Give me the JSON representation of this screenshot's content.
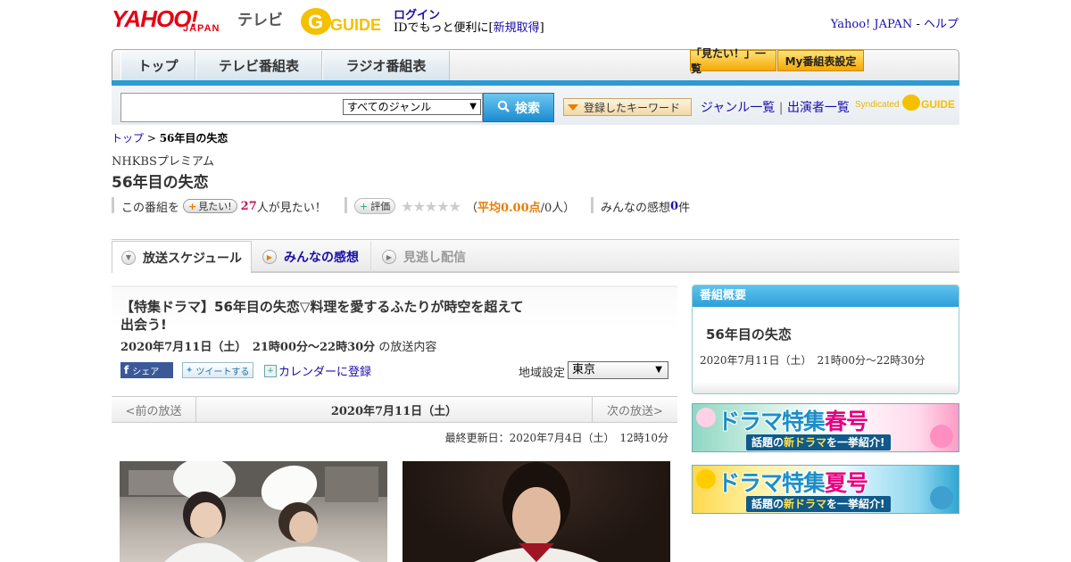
{
  "header": {
    "logo_yahoo": "YAHOO!",
    "logo_japan": "JAPAN",
    "logo_tv": "テレビ",
    "gguide_logo": "G GUIDE",
    "login": "ログイン",
    "login_prefix": "IDでもっと便利に[",
    "register": "新規取得",
    "login_suffix": "]",
    "yahoo_japan_link": "Yahoo! JAPAN",
    "help_sep": " - ",
    "help_link": "ヘルプ"
  },
  "nav": {
    "tabs": [
      "トップ",
      "テレビ番組表",
      "ラジオ番組表"
    ],
    "mitai_list": "「見たい！」一覧",
    "my_settings": "My番組表設定"
  },
  "search": {
    "genre_selected": "すべてのジャンル",
    "search_button": "検索",
    "keyword_button": "登録したキーワード",
    "genre_list_link": "ジャンル一覧",
    "link_sep": "|",
    "performer_list_link": "出演者一覧",
    "syndicated": "Syndicated"
  },
  "breadcrumb": {
    "top": "トップ",
    "sep": " > ",
    "current": "56年目の失恋"
  },
  "program": {
    "channel": "NHKBSプレミアム",
    "title": "56年目の失恋",
    "this_program": "この番組を",
    "mitai_button": "見たい!",
    "mitai_count": "27",
    "mitai_suffix": "人が見たい！",
    "rating_button": "評価",
    "stars": "★★★★★",
    "avg_prefix": "（",
    "avg_label": "平均0.00点",
    "avg_suffix": "/0人）",
    "impressions_prefix": "みんなの感想 ",
    "impressions_count": "0",
    "impressions_suffix": "件"
  },
  "page_tabs": {
    "schedule": "放送スケジュール",
    "impressions": "みんなの感想",
    "missed": "見逃し配信"
  },
  "episode": {
    "title": "【特集ドラマ】56年目の失恋▽料理を愛するふたりが時空を超えて出会う!",
    "date": "2020年7月11日（土）　21時00分～22時30分",
    "date_suffix": "の放送内容",
    "share": "シェア",
    "tweet": "ツイートする",
    "calendar": "カレンダーに登録",
    "region_label": "地域設定",
    "region_selected": "東京"
  },
  "broadcast_nav": {
    "prev": "<前の放送",
    "date": "2020年7月11日（土）",
    "next": "次の放送>",
    "updated": "最終更新日：2020年7月4日（土）　12時10分"
  },
  "sidebar": {
    "summary_heading": "番組概要",
    "title": "56年目の失恋",
    "date": "2020年7月11日（土）　21時00分～22時30分",
    "banner_spring_main": "ドラマ特集",
    "banner_spring_season": "春号",
    "banner_summer_main": "ドラマ特集",
    "banner_summer_season": "夏号",
    "banner_sub_prefix": "話題の",
    "banner_sub_new": "新ドラマ",
    "banner_sub_suffix": "を一挙紹介!"
  },
  "colors": {
    "accent_blue": "#2a9bd5",
    "yahoo_red": "#e60012",
    "orange": "#e87d00",
    "pink": "#c2185b"
  }
}
